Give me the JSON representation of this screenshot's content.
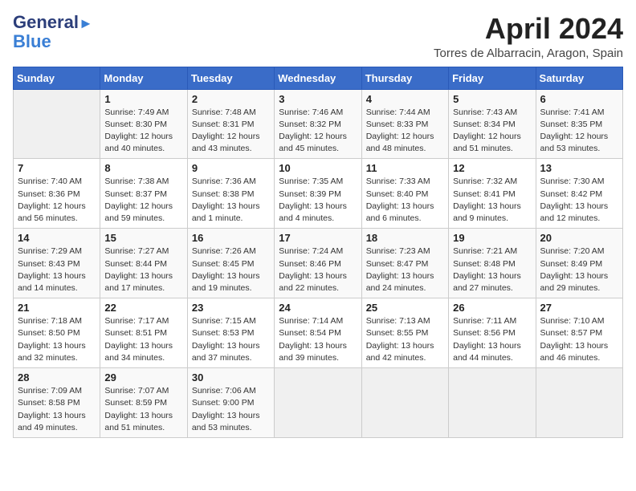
{
  "logo": {
    "general": "General",
    "blue": "Blue"
  },
  "title": "April 2024",
  "location": "Torres de Albarracin, Aragon, Spain",
  "days_of_week": [
    "Sunday",
    "Monday",
    "Tuesday",
    "Wednesday",
    "Thursday",
    "Friday",
    "Saturday"
  ],
  "weeks": [
    [
      {
        "num": "",
        "info": ""
      },
      {
        "num": "1",
        "info": "Sunrise: 7:49 AM\nSunset: 8:30 PM\nDaylight: 12 hours\nand 40 minutes."
      },
      {
        "num": "2",
        "info": "Sunrise: 7:48 AM\nSunset: 8:31 PM\nDaylight: 12 hours\nand 43 minutes."
      },
      {
        "num": "3",
        "info": "Sunrise: 7:46 AM\nSunset: 8:32 PM\nDaylight: 12 hours\nand 45 minutes."
      },
      {
        "num": "4",
        "info": "Sunrise: 7:44 AM\nSunset: 8:33 PM\nDaylight: 12 hours\nand 48 minutes."
      },
      {
        "num": "5",
        "info": "Sunrise: 7:43 AM\nSunset: 8:34 PM\nDaylight: 12 hours\nand 51 minutes."
      },
      {
        "num": "6",
        "info": "Sunrise: 7:41 AM\nSunset: 8:35 PM\nDaylight: 12 hours\nand 53 minutes."
      }
    ],
    [
      {
        "num": "7",
        "info": "Sunrise: 7:40 AM\nSunset: 8:36 PM\nDaylight: 12 hours\nand 56 minutes."
      },
      {
        "num": "8",
        "info": "Sunrise: 7:38 AM\nSunset: 8:37 PM\nDaylight: 12 hours\nand 59 minutes."
      },
      {
        "num": "9",
        "info": "Sunrise: 7:36 AM\nSunset: 8:38 PM\nDaylight: 13 hours\nand 1 minute."
      },
      {
        "num": "10",
        "info": "Sunrise: 7:35 AM\nSunset: 8:39 PM\nDaylight: 13 hours\nand 4 minutes."
      },
      {
        "num": "11",
        "info": "Sunrise: 7:33 AM\nSunset: 8:40 PM\nDaylight: 13 hours\nand 6 minutes."
      },
      {
        "num": "12",
        "info": "Sunrise: 7:32 AM\nSunset: 8:41 PM\nDaylight: 13 hours\nand 9 minutes."
      },
      {
        "num": "13",
        "info": "Sunrise: 7:30 AM\nSunset: 8:42 PM\nDaylight: 13 hours\nand 12 minutes."
      }
    ],
    [
      {
        "num": "14",
        "info": "Sunrise: 7:29 AM\nSunset: 8:43 PM\nDaylight: 13 hours\nand 14 minutes."
      },
      {
        "num": "15",
        "info": "Sunrise: 7:27 AM\nSunset: 8:44 PM\nDaylight: 13 hours\nand 17 minutes."
      },
      {
        "num": "16",
        "info": "Sunrise: 7:26 AM\nSunset: 8:45 PM\nDaylight: 13 hours\nand 19 minutes."
      },
      {
        "num": "17",
        "info": "Sunrise: 7:24 AM\nSunset: 8:46 PM\nDaylight: 13 hours\nand 22 minutes."
      },
      {
        "num": "18",
        "info": "Sunrise: 7:23 AM\nSunset: 8:47 PM\nDaylight: 13 hours\nand 24 minutes."
      },
      {
        "num": "19",
        "info": "Sunrise: 7:21 AM\nSunset: 8:48 PM\nDaylight: 13 hours\nand 27 minutes."
      },
      {
        "num": "20",
        "info": "Sunrise: 7:20 AM\nSunset: 8:49 PM\nDaylight: 13 hours\nand 29 minutes."
      }
    ],
    [
      {
        "num": "21",
        "info": "Sunrise: 7:18 AM\nSunset: 8:50 PM\nDaylight: 13 hours\nand 32 minutes."
      },
      {
        "num": "22",
        "info": "Sunrise: 7:17 AM\nSunset: 8:51 PM\nDaylight: 13 hours\nand 34 minutes."
      },
      {
        "num": "23",
        "info": "Sunrise: 7:15 AM\nSunset: 8:53 PM\nDaylight: 13 hours\nand 37 minutes."
      },
      {
        "num": "24",
        "info": "Sunrise: 7:14 AM\nSunset: 8:54 PM\nDaylight: 13 hours\nand 39 minutes."
      },
      {
        "num": "25",
        "info": "Sunrise: 7:13 AM\nSunset: 8:55 PM\nDaylight: 13 hours\nand 42 minutes."
      },
      {
        "num": "26",
        "info": "Sunrise: 7:11 AM\nSunset: 8:56 PM\nDaylight: 13 hours\nand 44 minutes."
      },
      {
        "num": "27",
        "info": "Sunrise: 7:10 AM\nSunset: 8:57 PM\nDaylight: 13 hours\nand 46 minutes."
      }
    ],
    [
      {
        "num": "28",
        "info": "Sunrise: 7:09 AM\nSunset: 8:58 PM\nDaylight: 13 hours\nand 49 minutes."
      },
      {
        "num": "29",
        "info": "Sunrise: 7:07 AM\nSunset: 8:59 PM\nDaylight: 13 hours\nand 51 minutes."
      },
      {
        "num": "30",
        "info": "Sunrise: 7:06 AM\nSunset: 9:00 PM\nDaylight: 13 hours\nand 53 minutes."
      },
      {
        "num": "",
        "info": ""
      },
      {
        "num": "",
        "info": ""
      },
      {
        "num": "",
        "info": ""
      },
      {
        "num": "",
        "info": ""
      }
    ]
  ]
}
